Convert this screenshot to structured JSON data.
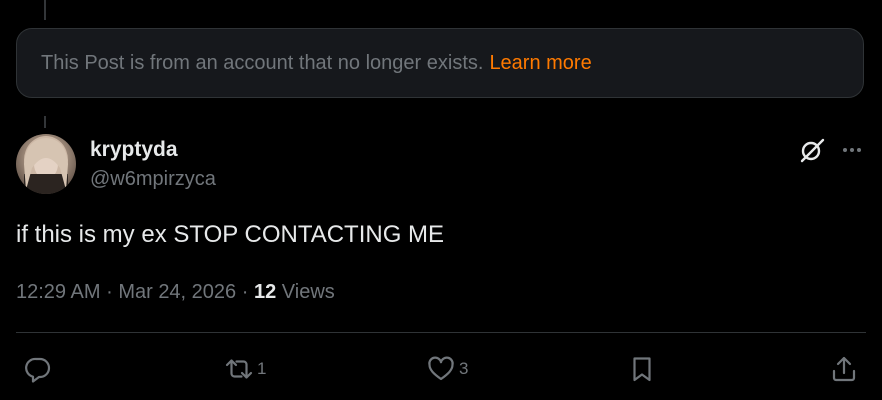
{
  "notice": {
    "text": "This Post is from an account that no longer exists.",
    "link": "Learn more",
    "link_color": "#ff7a00"
  },
  "author": {
    "display_name": "kryptyda",
    "handle": "@w6mpirzyca"
  },
  "post": {
    "text": "if this is my ex STOP CONTACTING ME"
  },
  "meta": {
    "time": "12:29 AM",
    "separator1": "·",
    "date": "Mar 24, 2026",
    "separator2": "·",
    "views_count": "12",
    "views_label": "Views"
  },
  "actions": {
    "reply": {
      "icon": "reply-icon",
      "count": ""
    },
    "repost": {
      "icon": "repost-icon",
      "count": "1"
    },
    "like": {
      "icon": "heart-icon",
      "count": "3"
    },
    "bookmark": {
      "icon": "bookmark-icon",
      "count": ""
    },
    "share": {
      "icon": "share-icon",
      "count": ""
    }
  },
  "colors": {
    "background": "#000000",
    "primary_text": "#e7e9ea",
    "secondary_text": "#71767b",
    "border": "#2f3336"
  }
}
